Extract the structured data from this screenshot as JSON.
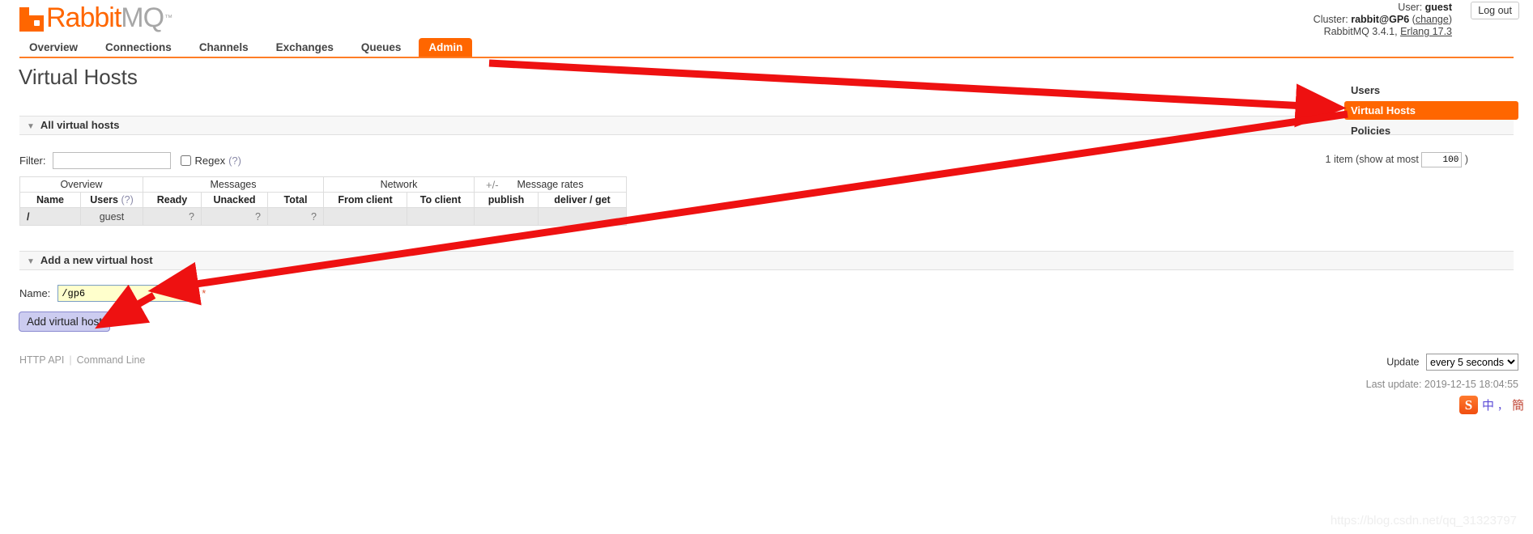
{
  "brand": {
    "name_first": "Rabbit",
    "name_second": "MQ",
    "tm": "™"
  },
  "header": {
    "user_label": "User:",
    "user_name": "guest",
    "cluster_label": "Cluster:",
    "cluster_name": "rabbit@GP6",
    "cluster_change": "change",
    "version_line": "RabbitMQ 3.4.1,",
    "erlang": "Erlang 17.3",
    "logout": "Log out"
  },
  "nav": {
    "tabs": [
      {
        "label": "Overview",
        "selected": false
      },
      {
        "label": "Connections",
        "selected": false
      },
      {
        "label": "Channels",
        "selected": false
      },
      {
        "label": "Exchanges",
        "selected": false
      },
      {
        "label": "Queues",
        "selected": false
      },
      {
        "label": "Admin",
        "selected": true
      }
    ]
  },
  "page": {
    "title": "Virtual Hosts"
  },
  "sections": {
    "all_vhosts": "All virtual hosts",
    "add_vhost": "Add a new virtual host"
  },
  "filter": {
    "label": "Filter:",
    "value": "",
    "placeholder": "",
    "regex_label": "Regex",
    "regex_help": "(?)",
    "regex_checked": false
  },
  "paging": {
    "prefix": "1 item (show at most",
    "limit": "100",
    "suffix": ")"
  },
  "table": {
    "group_headers": [
      {
        "label": "Overview",
        "colspan": 2
      },
      {
        "label": "Messages",
        "colspan": 3
      },
      {
        "label": "Network",
        "colspan": 2
      },
      {
        "label": "Message rates",
        "colspan": 2
      }
    ],
    "plus_minus": "+/-",
    "columns": [
      "Name",
      "Users",
      "Ready",
      "Unacked",
      "Total",
      "From client",
      "To client",
      "publish",
      "deliver / get"
    ],
    "users_help": "(?)",
    "rows": [
      {
        "name": "/",
        "users": "guest",
        "ready": "?",
        "unacked": "?",
        "total": "?",
        "from_client": "",
        "to_client": "",
        "publish": "",
        "deliver_get": ""
      }
    ]
  },
  "add_form": {
    "name_label": "Name:",
    "name_value": "/gp6",
    "name_placeholder": "",
    "required_mark": "*",
    "submit_label": "Add virtual host"
  },
  "sidebar": {
    "items": [
      {
        "label": "Users",
        "selected": false
      },
      {
        "label": "Virtual Hosts",
        "selected": true
      },
      {
        "label": "Policies",
        "selected": false
      }
    ]
  },
  "footer": {
    "http_api": "HTTP API",
    "command_line": "Command Line",
    "update_label": "Update",
    "update_value": "every 5 seconds",
    "update_options": [
      "every 5 seconds"
    ],
    "last_update": "Last update: 2019-12-15 18:04:55"
  },
  "ime": {
    "logo": "S",
    "mode": "中",
    "punct": "，",
    "script": "簡"
  },
  "watermark": "https://blog.csdn.net/qq_31323797",
  "colors": {
    "brand_orange": "#f60",
    "brand_grey": "#a7a7a7",
    "annotation_red": "#ee1111",
    "input_highlight": "#ffffcc"
  }
}
